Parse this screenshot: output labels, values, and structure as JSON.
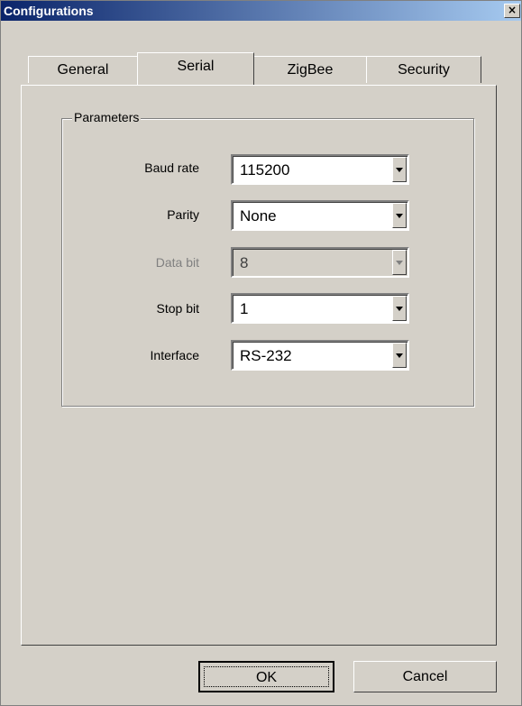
{
  "window": {
    "title": "Configurations",
    "close_label": "×"
  },
  "tabs": [
    {
      "label": "General",
      "active": false
    },
    {
      "label": "Serial",
      "active": true
    },
    {
      "label": "ZigBee",
      "active": false
    },
    {
      "label": "Security",
      "active": false
    }
  ],
  "group": {
    "legend": "Parameters",
    "fields": [
      {
        "label": "Baud rate",
        "value": "115200",
        "enabled": true
      },
      {
        "label": "Parity",
        "value": "None",
        "enabled": true
      },
      {
        "label": "Data bit",
        "value": "8",
        "enabled": false
      },
      {
        "label": "Stop bit",
        "value": "1",
        "enabled": true
      },
      {
        "label": "Interface",
        "value": "RS-232",
        "enabled": true
      }
    ]
  },
  "buttons": {
    "ok": "OK",
    "cancel": "Cancel"
  },
  "icons": {
    "close": "close-icon",
    "dropdown": "chevron-down-icon"
  }
}
